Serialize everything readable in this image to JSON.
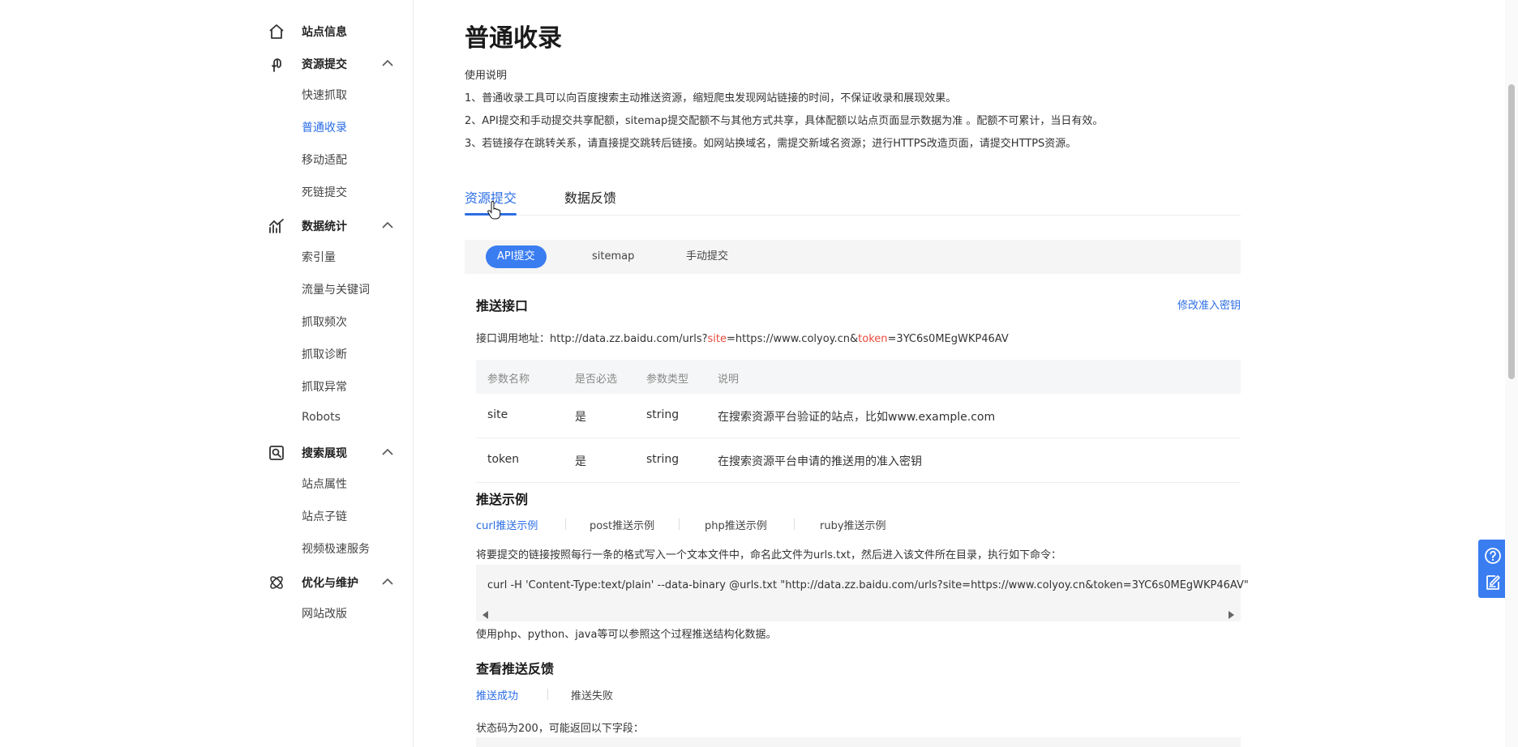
{
  "sidebar": {
    "groups": [
      {
        "label": "站点信息",
        "icon": "home-icon"
      },
      {
        "label": "资源提交",
        "icon": "resource-submit-icon"
      },
      {
        "label": "数据统计",
        "icon": "chart-icon"
      },
      {
        "label": "搜索展现",
        "icon": "search-display-icon"
      },
      {
        "label": "优化与维护",
        "icon": "optimize-icon"
      }
    ],
    "items": {
      "quick_crawl": "快速抓取",
      "normal_index": "普通收录",
      "mobile_adapt": "移动适配",
      "dead_link": "死链提交",
      "index_volume": "索引量",
      "traffic_keywords": "流量与关键词",
      "crawl_frequency": "抓取频次",
      "crawl_diagnose": "抓取诊断",
      "crawl_error": "抓取异常",
      "robots": "Robots",
      "site_attributes": "站点属性",
      "site_sublinks": "站点子链",
      "video_speed": "视频极速服务",
      "site_revision": "网站改版"
    }
  },
  "main": {
    "title": "普通收录",
    "usage_title": "使用说明",
    "usage_lines": [
      "1、普通收录工具可以向百度搜索主动推送资源，缩短爬虫发现网站链接的时间，不保证收录和展现效果。",
      "2、API提交和手动提交共享配额，sitemap提交配额不与其他方式共享，具体配额以站点页面显示数据为准 。配额不可累计，当日有效。",
      "3、若链接存在跳转关系，请直接提交跳转后链接。如网站换域名，需提交新域名资源；进行HTTPS改造页面，请提交HTTPS资源。"
    ],
    "tabs": [
      "资源提交",
      "数据反馈"
    ],
    "subtabs": [
      "API提交",
      "sitemap",
      "手动提交"
    ],
    "push_api": {
      "title": "推送接口",
      "modify_key_link": "修改准入密钥",
      "url_prefix": "接口调用地址：http://data.zz.baidu.com/urls?",
      "param_site": "site",
      "url_mid": "=https://www.colyoy.cn&",
      "param_token": "token",
      "url_suffix": "=3YC6s0MEgWKP46AV"
    },
    "param_table": {
      "headers": [
        "参数名称",
        "是否必选",
        "参数类型",
        "说明"
      ],
      "rows": [
        [
          "site",
          "是",
          "string",
          "在搜索资源平台验证的站点，比如www.example.com"
        ],
        [
          "token",
          "是",
          "string",
          "在搜索资源平台申请的推送用的准入密钥"
        ]
      ]
    },
    "push_example": {
      "title": "推送示例",
      "tabs": [
        "curl推送示例",
        "post推送示例",
        "php推送示例",
        "ruby推送示例"
      ],
      "instruction": "将要提交的链接按照每行一条的格式写入一个文本文件中，命名此文件为urls.txt，然后进入该文件所在目录，执行如下命令：",
      "code": "curl -H 'Content-Type:text/plain' --data-binary @urls.txt \"http://data.zz.baidu.com/urls?site=https://www.colyoy.cn&token=3YC6s0MEgWKP46AV\"",
      "note": "使用php、python、java等可以参照这个过程推送结构化数据。"
    },
    "feedback": {
      "title": "查看推送反馈",
      "tabs": [
        "推送成功",
        "推送失败"
      ],
      "status_text": "状态码为200，可能返回以下字段："
    }
  },
  "float_tools": [
    "help-icon",
    "feedback-edit-icon"
  ],
  "colors": {
    "accent": "#2b6de5",
    "accent_button": "#3a7df0",
    "highlight_red": "#e84b3c"
  }
}
